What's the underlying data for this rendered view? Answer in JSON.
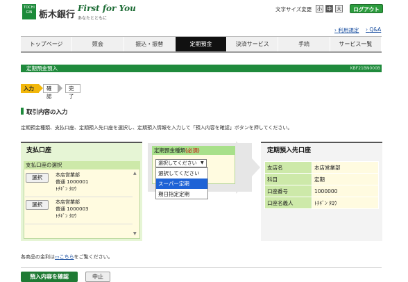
{
  "header": {
    "logo_text": "TOCHI GIN",
    "bank_name": "栃木銀行",
    "slogan": "First for You",
    "slogan_sub": "あなたとともに",
    "text_size_label": "文字サイズ変更",
    "text_size_small": "小",
    "text_size_mid": "中",
    "text_size_big": "大",
    "logout": "ログアウト",
    "link_terms": "利用規定",
    "link_qa": "Q&A"
  },
  "nav": {
    "items": [
      "トップページ",
      "照会",
      "振込・振替",
      "定期預金",
      "決済サービス",
      "手続",
      "サービス一覧"
    ],
    "active_index": 3
  },
  "title_bar": {
    "title": "定期預金預入",
    "code": "KBF21BN000B"
  },
  "steps": [
    "入力",
    "確認",
    "完了"
  ],
  "section_title": "取引内容の入力",
  "instructions": "定期預金種類、支払口座、定期預入先口座を選択し、定期預入情報を入力して「預入内容を確認」ボタンを押してください。",
  "left_panel": {
    "title": "支払口座",
    "inner_title": "支払口座の選択",
    "select_label": "選択",
    "accounts": [
      {
        "branch": "本店営業部",
        "number": "普通 1000001",
        "name": "ﾄﾁｷﾞﾝ ﾀﾛｳ"
      },
      {
        "branch": "本店営業部",
        "number": "普通 1000003",
        "name": "ﾄﾁｷﾞﾝ ﾀﾛｳ"
      }
    ]
  },
  "middle": {
    "head_label": "定期預金種類",
    "required": "(必須)",
    "select_value": "選択してください",
    "options": [
      "選択してください",
      "スーパー定期",
      "期日指定定期"
    ],
    "selected_option_index": 1
  },
  "right_panel": {
    "title": "定期預入先口座",
    "rows": [
      {
        "key": "支店名",
        "value": "本店営業部"
      },
      {
        "key": "科目",
        "value": "定期"
      },
      {
        "key": "口座番号",
        "value": "1000000"
      },
      {
        "key": "口座名義人",
        "value": "ﾄﾁｷﾞﾝ ﾀﾛｳ"
      }
    ]
  },
  "note": {
    "prefix": "各商品の金利は",
    "link": "こちら",
    "suffix": "をご覧ください。"
  },
  "buttons": {
    "confirm": "預入内容を確認",
    "cancel": "中止"
  },
  "colors": {
    "brand_green": "#1f8a3c",
    "accent_yellow": "#f2b70b",
    "selected_blue": "#1e63d6"
  }
}
